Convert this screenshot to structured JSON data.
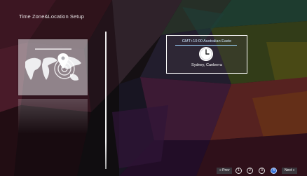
{
  "screen": {
    "title": "Time Zone&Location Setup"
  },
  "timezone": {
    "label": "GMT+10:00 Australian Easte",
    "city": "Sydney, Canberra"
  },
  "left_card": {
    "icon": "world-map-location-icon"
  },
  "navigation": {
    "prev_label": "« Prev",
    "next_label": "Next »",
    "steps": [
      "1",
      "2",
      "3",
      "4"
    ],
    "active_step": 4
  },
  "colors": {
    "active_step": "#3a74d8",
    "tz_label": "#cfe8ff"
  }
}
